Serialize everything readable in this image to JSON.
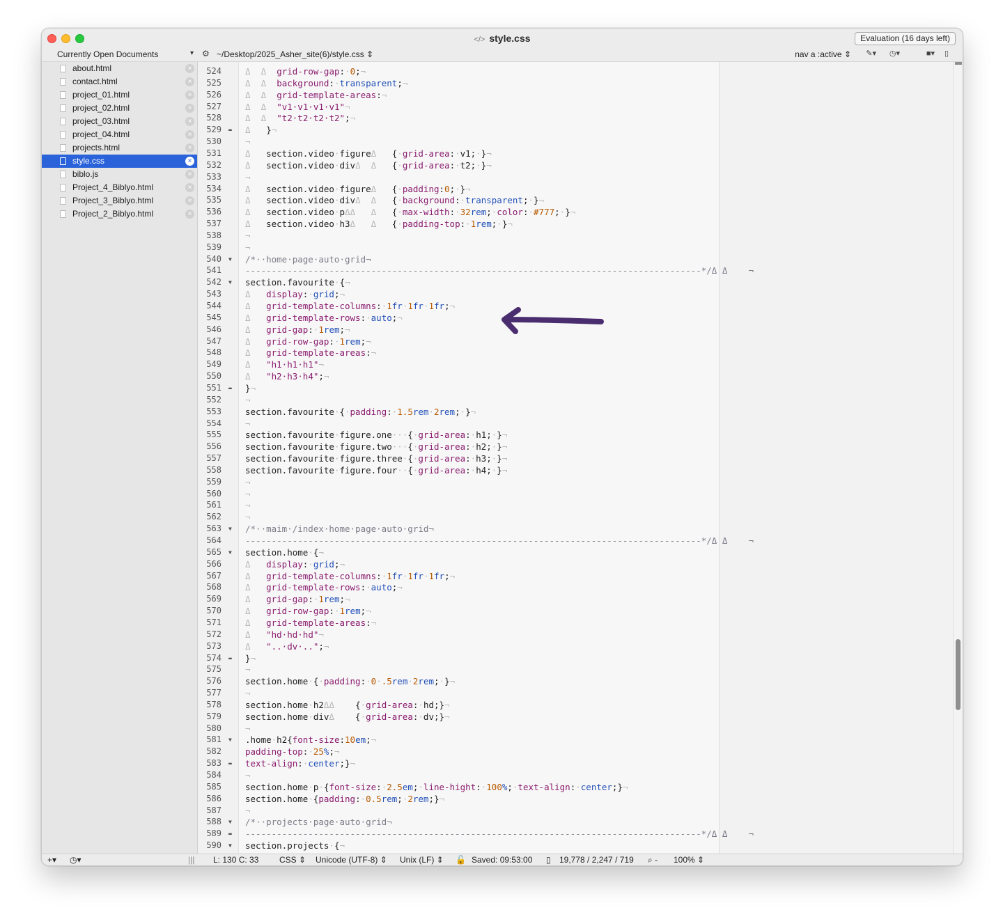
{
  "window": {
    "title": "style.css",
    "evaluation_label": "Evaluation (16 days left)"
  },
  "pathbar": {
    "documents_menu": "Currently Open Documents",
    "file_path": "~/Desktop/2025_Asher_site(6)/style.css",
    "symbol_selector": "nav a :active"
  },
  "sidebar": {
    "items": [
      {
        "label": "about.html",
        "selected": false
      },
      {
        "label": "contact.html",
        "selected": false
      },
      {
        "label": "project_01.html",
        "selected": false
      },
      {
        "label": "project_02.html",
        "selected": false
      },
      {
        "label": "project_03.html",
        "selected": false
      },
      {
        "label": "project_04.html",
        "selected": false
      },
      {
        "label": "projects.html",
        "selected": false
      },
      {
        "label": "style.css",
        "selected": true
      },
      {
        "label": "biblo.js",
        "selected": false
      },
      {
        "label": "Project_4_Biblyo.html",
        "selected": false
      },
      {
        "label": "Project_3_Biblyo.html",
        "selected": false
      },
      {
        "label": "Project_2_Biblyo.html",
        "selected": false
      }
    ]
  },
  "editor": {
    "lines": [
      {
        "n": "524",
        "fold": "",
        "code": "Δ  Δ  grid-row-gap:·0;¬"
      },
      {
        "n": "525",
        "fold": "",
        "code": "Δ  Δ  background:·transparent;¬"
      },
      {
        "n": "526",
        "fold": "",
        "code": "Δ  Δ  grid-template-areas:¬"
      },
      {
        "n": "527",
        "fold": "",
        "code": "Δ  Δ  \"v1·v1·v1·v1\"¬"
      },
      {
        "n": "528",
        "fold": "",
        "code": "Δ  Δ  \"t2·t2·t2·t2\";¬"
      },
      {
        "n": "529",
        "fold": "end",
        "code": "Δ   }¬"
      },
      {
        "n": "530",
        "fold": "",
        "code": "¬"
      },
      {
        "n": "531",
        "fold": "",
        "code": "Δ   section.video·figureΔ   {·grid-area:·v1;·}¬"
      },
      {
        "n": "532",
        "fold": "",
        "code": "Δ   section.video·divΔ  Δ   {·grid-area:·t2;·}¬"
      },
      {
        "n": "533",
        "fold": "",
        "code": "¬"
      },
      {
        "n": "534",
        "fold": "",
        "code": "Δ   section.video·figureΔ   {·padding:0;·}¬"
      },
      {
        "n": "535",
        "fold": "",
        "code": "Δ   section.video·divΔ  Δ   {·background:·transparent;·}¬"
      },
      {
        "n": "536",
        "fold": "",
        "code": "Δ   section.video·pΔΔ   Δ   {·max-width:·32rem;·color:·#777;·}¬"
      },
      {
        "n": "537",
        "fold": "",
        "code": "Δ   section.video·h3Δ   Δ   {·padding-top:·1rem;·}¬"
      },
      {
        "n": "538",
        "fold": "",
        "code": "¬"
      },
      {
        "n": "539",
        "fold": "",
        "code": "¬"
      },
      {
        "n": "540",
        "fold": "open",
        "code": "/*··home·page·auto·grid¬"
      },
      {
        "n": "541",
        "fold": "",
        "code": "---------------------------------------------------------------------------------------*/Δ Δ    ¬"
      },
      {
        "n": "542",
        "fold": "open",
        "code": "section.favourite·{¬"
      },
      {
        "n": "543",
        "fold": "",
        "code": "Δ   display:·grid;¬"
      },
      {
        "n": "544",
        "fold": "",
        "code": "Δ   grid-template-columns:·1fr·1fr·1fr;¬"
      },
      {
        "n": "545",
        "fold": "",
        "code": "Δ   grid-template-rows:·auto;¬"
      },
      {
        "n": "546",
        "fold": "",
        "code": "Δ   grid-gap:·1rem;¬"
      },
      {
        "n": "547",
        "fold": "",
        "code": "Δ   grid-row-gap:·1rem;¬"
      },
      {
        "n": "548",
        "fold": "",
        "code": "Δ   grid-template-areas:¬"
      },
      {
        "n": "549",
        "fold": "",
        "code": "Δ   \"h1·h1·h1\"¬"
      },
      {
        "n": "550",
        "fold": "",
        "code": "Δ   \"h2·h3·h4\";¬"
      },
      {
        "n": "551",
        "fold": "end",
        "code": "}¬"
      },
      {
        "n": "552",
        "fold": "",
        "code": "¬"
      },
      {
        "n": "553",
        "fold": "",
        "code": "section.favourite·{·padding:·1.5rem·2rem;·}¬"
      },
      {
        "n": "554",
        "fold": "",
        "code": "¬"
      },
      {
        "n": "555",
        "fold": "",
        "code": "section.favourite·figure.one···{·grid-area:·h1;·}¬"
      },
      {
        "n": "556",
        "fold": "",
        "code": "section.favourite·figure.two···{·grid-area:·h2;·}¬"
      },
      {
        "n": "557",
        "fold": "",
        "code": "section.favourite·figure.three·{·grid-area:·h3;·}¬"
      },
      {
        "n": "558",
        "fold": "",
        "code": "section.favourite·figure.four··{·grid-area:·h4;·}¬"
      },
      {
        "n": "559",
        "fold": "",
        "code": "¬"
      },
      {
        "n": "560",
        "fold": "",
        "code": "¬"
      },
      {
        "n": "561",
        "fold": "",
        "code": "¬"
      },
      {
        "n": "562",
        "fold": "",
        "code": "¬"
      },
      {
        "n": "563",
        "fold": "open",
        "code": "/*··maim·/index·home·page·auto·grid¬"
      },
      {
        "n": "564",
        "fold": "",
        "code": "---------------------------------------------------------------------------------------*/Δ Δ    ¬"
      },
      {
        "n": "565",
        "fold": "open",
        "code": "section.home·{¬"
      },
      {
        "n": "566",
        "fold": "",
        "code": "Δ   display:·grid;¬"
      },
      {
        "n": "567",
        "fold": "",
        "code": "Δ   grid-template-columns:·1fr·1fr·1fr;¬"
      },
      {
        "n": "568",
        "fold": "",
        "code": "Δ   grid-template-rows:·auto;¬"
      },
      {
        "n": "569",
        "fold": "",
        "code": "Δ   grid-gap:·1rem;¬"
      },
      {
        "n": "570",
        "fold": "",
        "code": "Δ   grid-row-gap:·1rem;¬"
      },
      {
        "n": "571",
        "fold": "",
        "code": "Δ   grid-template-areas:¬"
      },
      {
        "n": "572",
        "fold": "",
        "code": "Δ   \"hd·hd·hd\"¬"
      },
      {
        "n": "573",
        "fold": "",
        "code": "Δ   \"..·dv·..\";¬"
      },
      {
        "n": "574",
        "fold": "end",
        "code": "}¬"
      },
      {
        "n": "575",
        "fold": "",
        "code": "¬"
      },
      {
        "n": "576",
        "fold": "",
        "code": "section.home·{·padding:·0·.5rem·2rem;·}¬"
      },
      {
        "n": "577",
        "fold": "",
        "code": "¬"
      },
      {
        "n": "578",
        "fold": "",
        "code": "section.home·h2ΔΔ    {·grid-area:·hd;}¬"
      },
      {
        "n": "579",
        "fold": "",
        "code": "section.home·divΔ    {·grid-area:·dv;}¬"
      },
      {
        "n": "580",
        "fold": "",
        "code": "¬"
      },
      {
        "n": "581",
        "fold": "open",
        "code": ".home·h2{font-size:10em;¬"
      },
      {
        "n": "582",
        "fold": "",
        "code": "padding-top:·25%;¬"
      },
      {
        "n": "583",
        "fold": "end",
        "code": "text-align:·center;}¬"
      },
      {
        "n": "584",
        "fold": "",
        "code": "¬"
      },
      {
        "n": "585",
        "fold": "",
        "code": "section.home·p·{font-size:·2.5em;·line-hight:·100%;·text-align:·center;}¬"
      },
      {
        "n": "586",
        "fold": "",
        "code": "section.home·{padding:·0.5rem;·2rem;}¬"
      },
      {
        "n": "587",
        "fold": "",
        "code": "¬"
      },
      {
        "n": "588",
        "fold": "open",
        "code": "/*··projects·page·auto·grid¬"
      },
      {
        "n": "589",
        "fold": "end",
        "code": "---------------------------------------------------------------------------------------*/Δ Δ    ¬"
      },
      {
        "n": "590",
        "fold": "open",
        "code": "section.projects·{¬"
      }
    ]
  },
  "statusbar": {
    "add_menu": "+",
    "cursor_position": "L: 130 C: 33",
    "language": "CSS",
    "encoding": "Unicode (UTF-8)",
    "line_endings": "Unix (LF)",
    "saved": "Saved: 09:53:00",
    "counts": "19,778 / 2,247 / 719",
    "zoom": "100%"
  },
  "annotation": {
    "arrow_color": "#4a2d6e"
  }
}
